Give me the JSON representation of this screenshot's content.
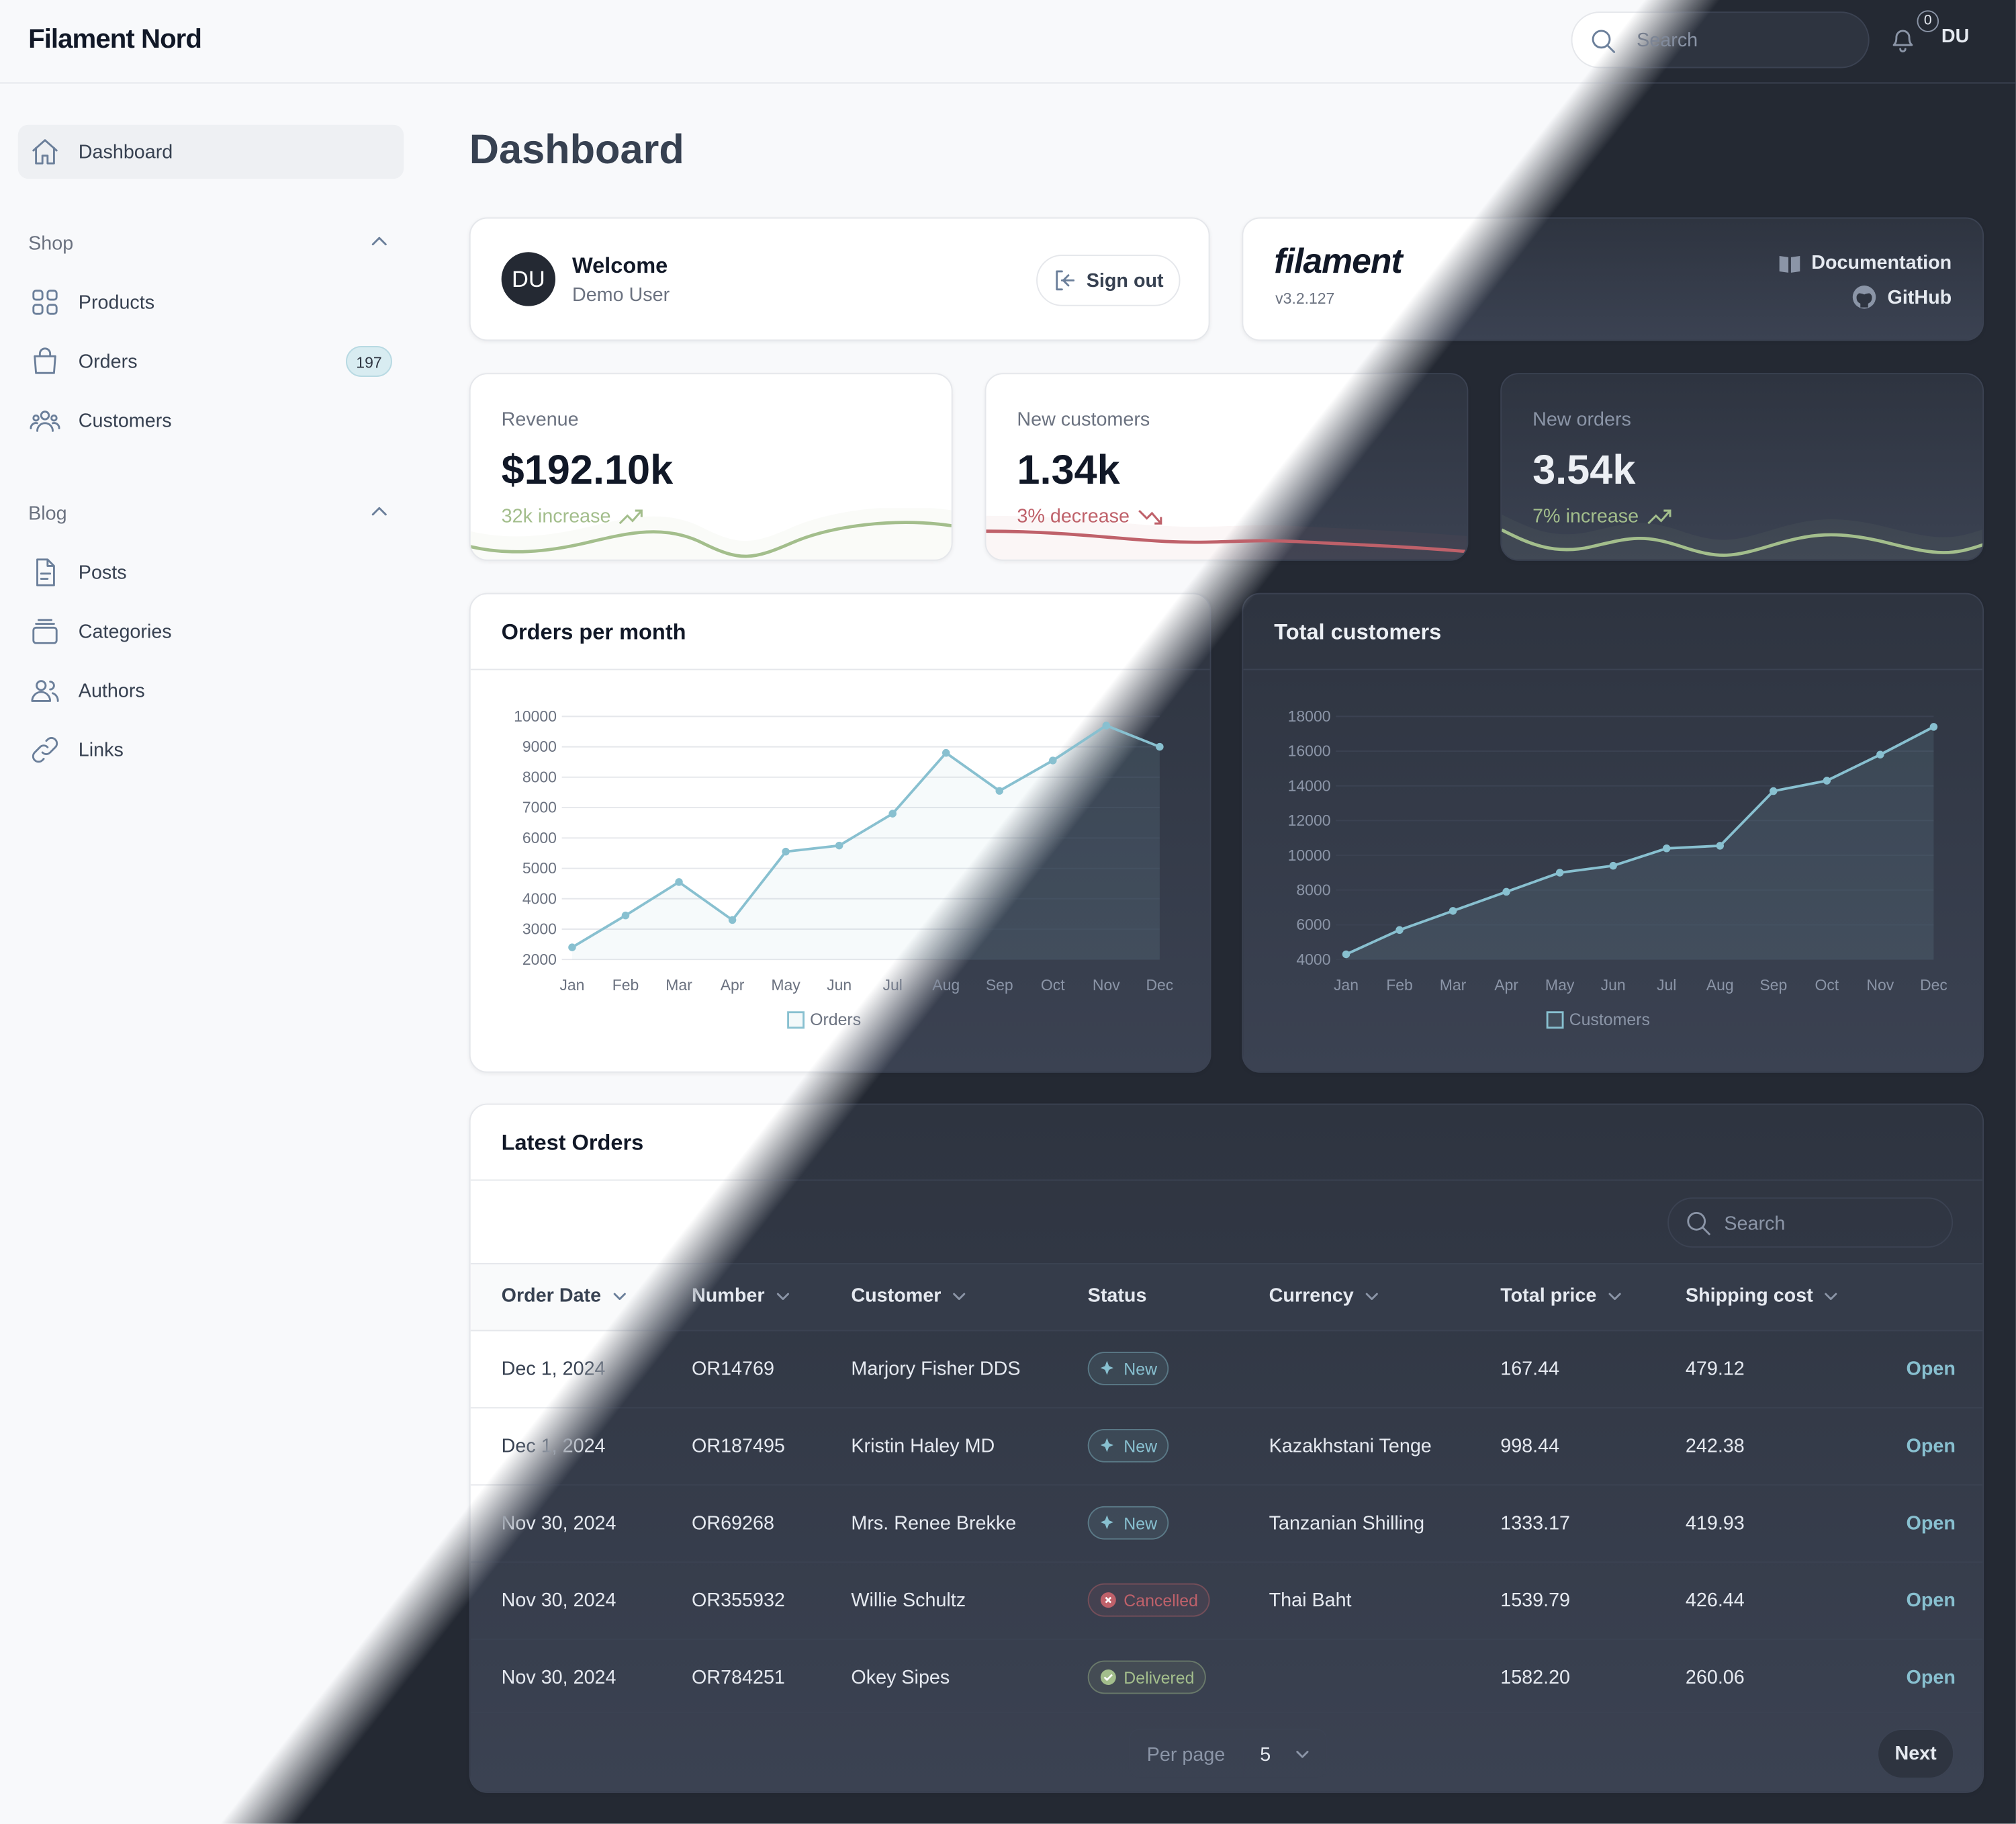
{
  "brand": "Filament Nord",
  "header": {
    "search_placeholder": "Search",
    "notifications_count": "0",
    "user_initials": "DU"
  },
  "sidebar": {
    "dashboard": "Dashboard",
    "groups": [
      {
        "label": "Shop",
        "items": [
          {
            "label": "Products",
            "icon": "squares-icon"
          },
          {
            "label": "Orders",
            "icon": "shopping-bag-icon",
            "badge": "197"
          },
          {
            "label": "Customers",
            "icon": "user-group-icon"
          }
        ]
      },
      {
        "label": "Blog",
        "items": [
          {
            "label": "Posts",
            "icon": "document-icon"
          },
          {
            "label": "Categories",
            "icon": "rectangle-stack-icon"
          },
          {
            "label": "Authors",
            "icon": "users-icon"
          },
          {
            "label": "Links",
            "icon": "link-icon"
          }
        ]
      }
    ]
  },
  "page_title": "Dashboard",
  "welcome": {
    "initials": "DU",
    "title": "Welcome",
    "name": "Demo User",
    "sign_out": "Sign out"
  },
  "filament": {
    "logo": "filament",
    "version": "v3.2.127",
    "documentation": "Documentation",
    "github": "GitHub"
  },
  "stats": [
    {
      "label": "Revenue",
      "value": "$192.10k",
      "desc": "32k increase",
      "trend": "up",
      "color": "#a3be8c"
    },
    {
      "label": "New customers",
      "value": "1.34k",
      "desc": "3% decrease",
      "trend": "down",
      "color": "#bf616a"
    },
    {
      "label": "New orders",
      "value": "3.54k",
      "desc": "7% increase",
      "trend": "up",
      "color": "#a3be8c"
    }
  ],
  "colors": {
    "accent": "#88c0d0",
    "success": "#a3be8c",
    "danger": "#bf616a"
  },
  "chart_data": [
    {
      "type": "line",
      "title": "Orders per month",
      "categories": [
        "Jan",
        "Feb",
        "Mar",
        "Apr",
        "May",
        "Jun",
        "Jul",
        "Aug",
        "Sep",
        "Oct",
        "Nov",
        "Dec"
      ],
      "series": [
        {
          "name": "Orders",
          "values": [
            2400,
            3450,
            4550,
            3300,
            5550,
            5750,
            6800,
            8800,
            7550,
            8550,
            9700,
            9000
          ]
        }
      ],
      "ylim": [
        2000,
        10000
      ],
      "yticks": [
        2000,
        3000,
        4000,
        5000,
        6000,
        7000,
        8000,
        9000,
        10000
      ],
      "grid": true,
      "legend": "bottom"
    },
    {
      "type": "line",
      "title": "Total customers",
      "categories": [
        "Jan",
        "Feb",
        "Mar",
        "Apr",
        "May",
        "Jun",
        "Jul",
        "Aug",
        "Sep",
        "Oct",
        "Nov",
        "Dec"
      ],
      "series": [
        {
          "name": "Customers",
          "values": [
            4300,
            5700,
            6800,
            7900,
            9000,
            9400,
            10400,
            10550,
            13700,
            14300,
            15800,
            17400
          ]
        }
      ],
      "ylim": [
        4000,
        18000
      ],
      "yticks": [
        4000,
        6000,
        8000,
        10000,
        12000,
        14000,
        16000,
        18000
      ],
      "grid": true,
      "legend": "bottom"
    }
  ],
  "orders": {
    "title": "Latest Orders",
    "search_placeholder": "Search",
    "columns": [
      "Order Date",
      "Number",
      "Customer",
      "Status",
      "Currency",
      "Total price",
      "Shipping cost"
    ],
    "rows": [
      {
        "date": "Dec 1, 2024",
        "number": "OR14769",
        "customer": "Marjory Fisher DDS",
        "status": "New",
        "currency": "",
        "total": "167.44",
        "shipping": "479.12",
        "action": "Open"
      },
      {
        "date": "Dec 1, 2024",
        "number": "OR187495",
        "customer": "Kristin Haley MD",
        "status": "New",
        "currency": "Kazakhstani Tenge",
        "total": "998.44",
        "shipping": "242.38",
        "action": "Open"
      },
      {
        "date": "Nov 30, 2024",
        "number": "OR69268",
        "customer": "Mrs. Renee Brekke",
        "status": "New",
        "currency": "Tanzanian Shilling",
        "total": "1333.17",
        "shipping": "419.93",
        "action": "Open"
      },
      {
        "date": "Nov 30, 2024",
        "number": "OR355932",
        "customer": "Willie Schultz",
        "status": "Cancelled",
        "currency": "Thai Baht",
        "total": "1539.79",
        "shipping": "426.44",
        "action": "Open"
      },
      {
        "date": "Nov 30, 2024",
        "number": "OR784251",
        "customer": "Okey Sipes",
        "status": "Delivered",
        "currency": "",
        "total": "1582.20",
        "shipping": "260.06",
        "action": "Open"
      }
    ],
    "per_page_label": "Per page",
    "per_page_value": "5",
    "next": "Next"
  }
}
